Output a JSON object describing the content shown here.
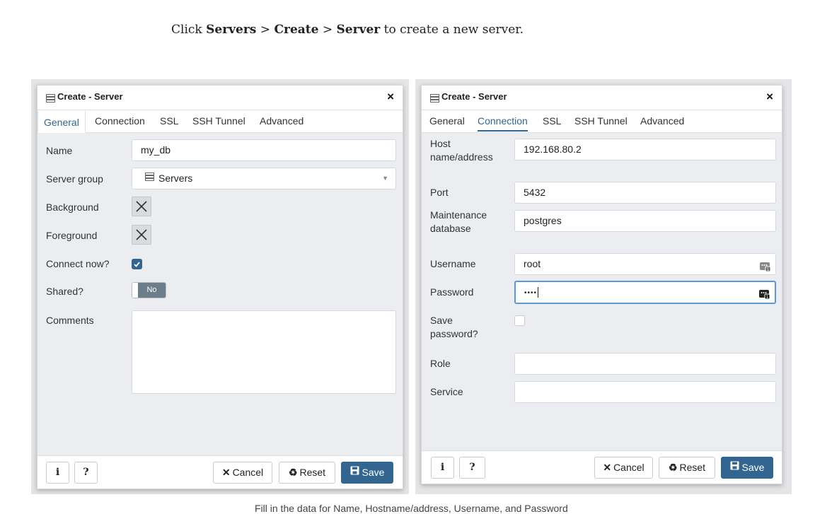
{
  "intro": {
    "pre": "Click ",
    "servers": "Servers",
    "sep1": " > ",
    "create": "Create",
    "sep2": " > ",
    "server": "Server",
    "post": " to create a new server."
  },
  "caption": "Fill in the data for Name, Hostname/address, Username, and Password",
  "colors": {
    "accent": "#326690",
    "focus": "#5b9bd5",
    "body_bg": "#ebedf0"
  },
  "left_dialog": {
    "title": "Create - Server",
    "close": "×",
    "tabs": [
      "General",
      "Connection",
      "SSL",
      "SSH Tunnel",
      "Advanced"
    ],
    "active_tab": "General",
    "fields": {
      "name": {
        "label": "Name",
        "value": "my_db"
      },
      "server_group": {
        "label": "Server group",
        "value": "Servers",
        "arrow": "▼"
      },
      "background": {
        "label": "Background"
      },
      "foreground": {
        "label": "Foreground"
      },
      "connect_now": {
        "label": "Connect now?",
        "checked": true
      },
      "shared": {
        "label": "Shared?",
        "state": "No"
      },
      "comments": {
        "label": "Comments",
        "value": ""
      }
    },
    "footer": {
      "info": "i",
      "help": "?",
      "cancel": "Cancel",
      "cancel_glyph": "✕",
      "reset": "Reset",
      "reset_glyph": "♻",
      "save": "Save"
    }
  },
  "right_dialog": {
    "title": "Create - Server",
    "close": "×",
    "tabs": [
      "General",
      "Connection",
      "SSL",
      "SSH Tunnel",
      "Advanced"
    ],
    "active_tab": "Connection",
    "fields": {
      "host": {
        "label1": "Host",
        "label2": "name/address",
        "value": "192.168.80.2"
      },
      "port": {
        "label": "Port",
        "value": "5432"
      },
      "maintenance_db": {
        "label1": "Maintenance",
        "label2": "database",
        "value": "postgres"
      },
      "username": {
        "label": "Username",
        "value": "root"
      },
      "password": {
        "label": "Password",
        "value": "••••"
      },
      "save_password": {
        "label1": "Save",
        "label2": "password?",
        "checked": false
      },
      "role": {
        "label": "Role",
        "value": ""
      },
      "service": {
        "label": "Service",
        "value": ""
      }
    },
    "footer": {
      "info": "i",
      "help": "?",
      "cancel": "Cancel",
      "cancel_glyph": "✕",
      "reset": "Reset",
      "reset_glyph": "♻",
      "save": "Save"
    }
  }
}
